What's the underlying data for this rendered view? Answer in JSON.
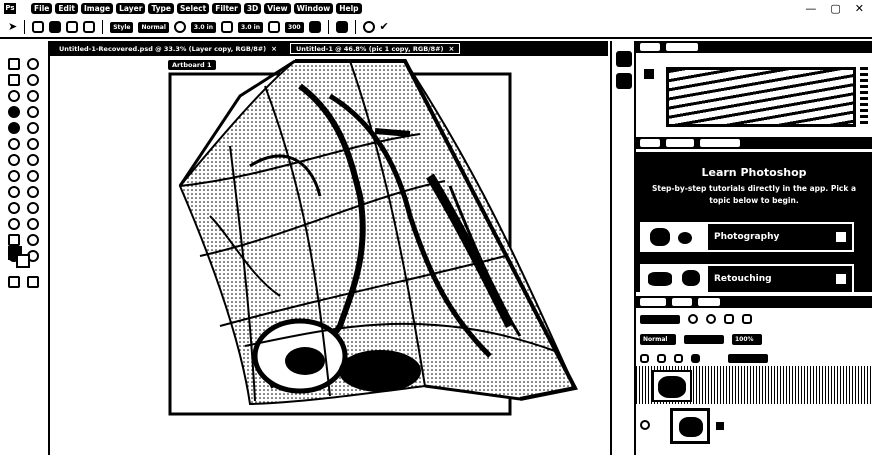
{
  "menu": {
    "logo": "Ps",
    "items": [
      "File",
      "Edit",
      "Image",
      "Layer",
      "Type",
      "Select",
      "Filter",
      "3D",
      "View",
      "Window",
      "Help"
    ],
    "win_min": "—",
    "win_max": "▢",
    "win_close": "✕"
  },
  "options": {
    "style_label": "Style",
    "style_value": "Normal",
    "width_value": "3.0 in",
    "height_value": "3.0 in",
    "resolution_value": "300"
  },
  "tabs": [
    {
      "label": "Untitled-1-Recovered.psd @ 33.3% (Layer copy, RGB/8#)",
      "close": "×"
    },
    {
      "label": "Untitled-1 @ 46.8% (pic 1 copy, RGB/8#)",
      "close": "×"
    }
  ],
  "canvas": {
    "artboard_label": "Artboard 1"
  },
  "learn": {
    "title": "Learn Photoshop",
    "subtitle_line1": "Step-by-step tutorials directly in the app. Pick a",
    "subtitle_line2": "topic below to begin.",
    "cards": [
      {
        "label": "Photography"
      },
      {
        "label": "Retouching"
      }
    ]
  },
  "layers": {
    "blend_mode": "Normal",
    "opacity_value": "100%"
  }
}
